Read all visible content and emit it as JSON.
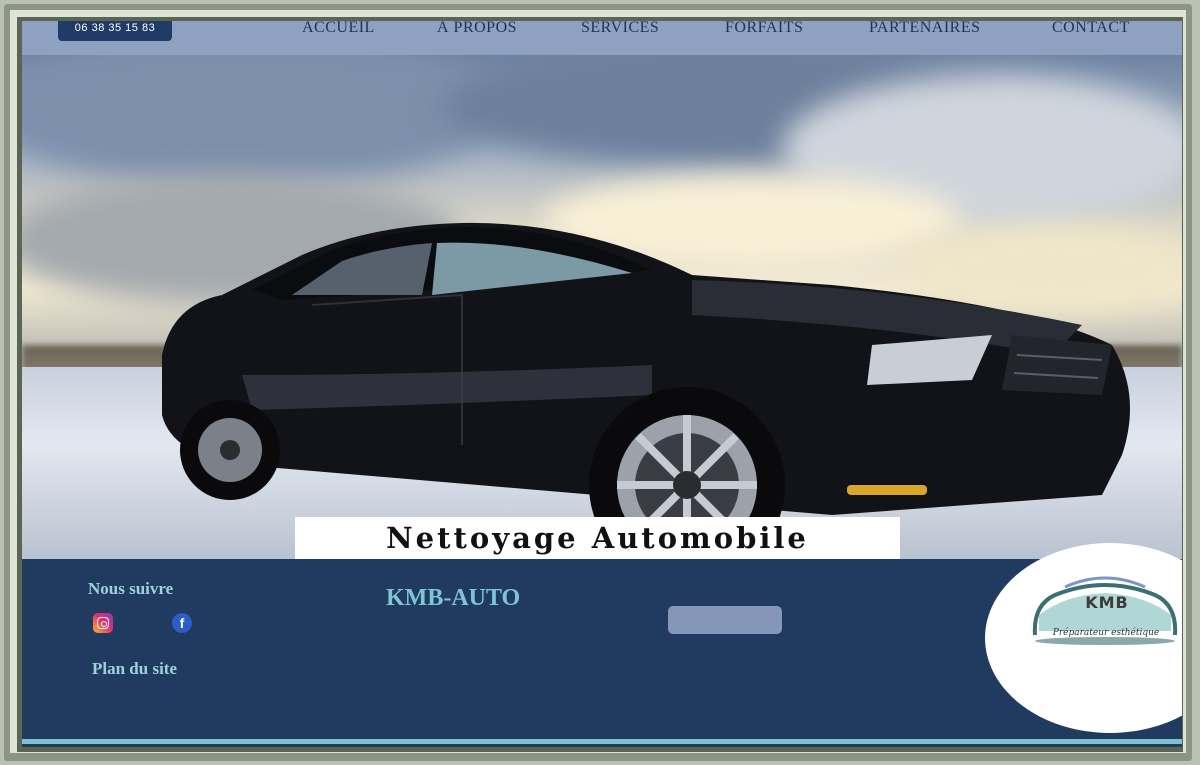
{
  "header": {
    "phone": "06 38 35 15 83",
    "nav": [
      "ACCUEIL",
      "À PROPOS",
      "SERVICES",
      "FORFAITS",
      "PARTENAIRES",
      "CONTACT"
    ]
  },
  "hero": {
    "caption": "Nettoyage Automobile"
  },
  "footer": {
    "follow_label": "Nous suivre",
    "social_icons": [
      "instagram-icon",
      "facebook-icon"
    ],
    "facebook_glyph": "f",
    "sitemap_label": "Plan du site",
    "brand": "KMB-AUTO"
  },
  "logo": {
    "text": "KMB",
    "tagline": "Préparateur esthétique"
  },
  "colors": {
    "nav_bar": "#8ea1c1",
    "footer_bg": "#213a5f",
    "accent": "#7cc5d5",
    "button": "#8596b8"
  }
}
